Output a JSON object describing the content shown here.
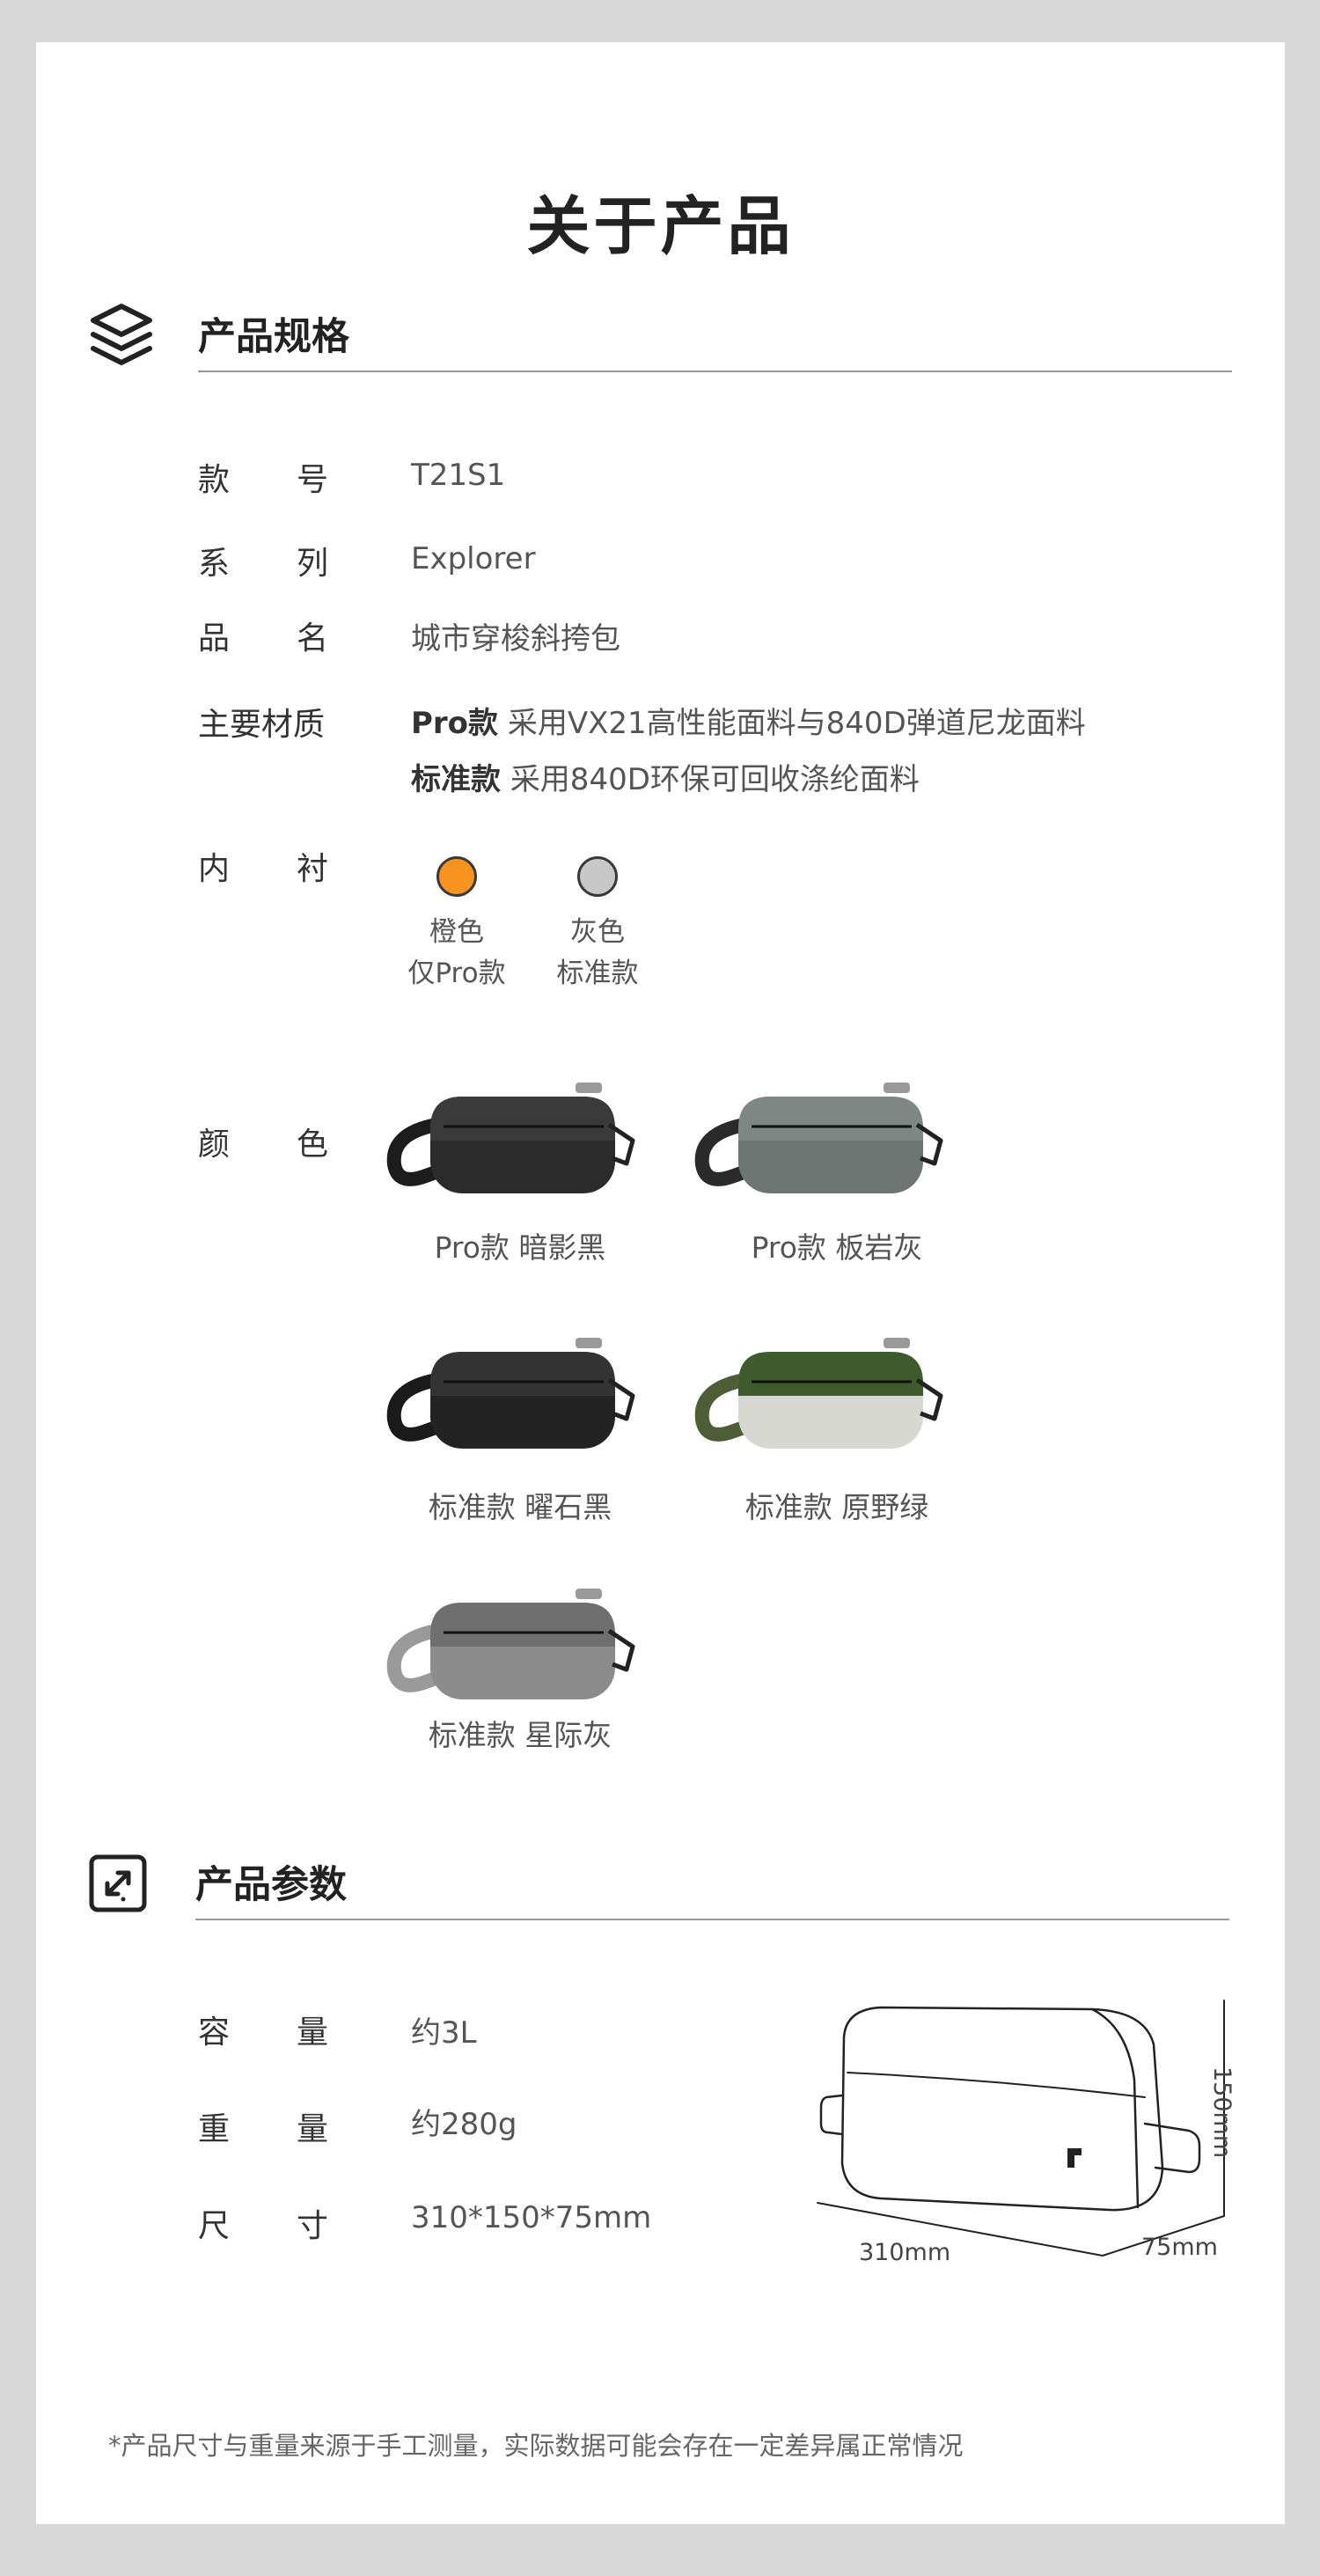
{
  "page_title": "关于产品",
  "spec_section": {
    "title": "产品规格",
    "icon": "layers-icon",
    "rows": {
      "model": {
        "label_a": "款",
        "label_b": "号",
        "value": "T21S1"
      },
      "series": {
        "label_a": "系",
        "label_b": "列",
        "value": "Explorer"
      },
      "name": {
        "label_a": "品",
        "label_b": "名",
        "value": "城市穿梭斜挎包"
      },
      "material": {
        "label": "主要材质",
        "pro_tag": "Pro款",
        "pro_text": "采用VX21高性能面料与840D弹道尼龙面料",
        "std_tag": "标准款",
        "std_text": "采用840D环保可回收涤纶面料"
      },
      "lining": {
        "label_a": "内",
        "label_b": "衬",
        "options": [
          {
            "name": "橙色",
            "note": "仅Pro款",
            "color": "#f7931e"
          },
          {
            "name": "灰色",
            "note": "标准款",
            "color": "#c8c8c8"
          }
        ]
      },
      "colors": {
        "label_a": "颜",
        "label_b": "色",
        "items": [
          {
            "caption": "Pro款 暗影黑",
            "body": "#2b2b2b",
            "top": "#3a3a3a",
            "strap": "#1c1c1c"
          },
          {
            "caption": "Pro款 板岩灰",
            "body": "#6d7572",
            "top": "#7f8784",
            "strap": "#2a2a2a"
          },
          {
            "caption": "标准款 曜石黑",
            "body": "#232323",
            "top": "#333333",
            "strap": "#1a1a1a"
          },
          {
            "caption": "标准款 原野绿",
            "body": "#d8d8d2",
            "top": "#3f5a2c",
            "strap": "#4d5d35"
          },
          {
            "caption": "标准款 星际灰",
            "body": "#8c8c8c",
            "top": "#6f6f6f",
            "strap": "#9a9a9a"
          }
        ]
      }
    }
  },
  "param_section": {
    "title": "产品参数",
    "icon": "expand-arrows-icon",
    "rows": {
      "capacity": {
        "label_a": "容",
        "label_b": "量",
        "value": "约3L"
      },
      "weight": {
        "label_a": "重",
        "label_b": "量",
        "value": "约280g"
      },
      "size": {
        "label_a": "尺",
        "label_b": "寸",
        "value": "310*150*75mm"
      }
    },
    "diagram": {
      "length": "310mm",
      "height": "150mm",
      "depth": "75mm"
    }
  },
  "footnote": "*产品尺寸与重量来源于手工测量，实际数据可能会存在一定差异属正常情况"
}
